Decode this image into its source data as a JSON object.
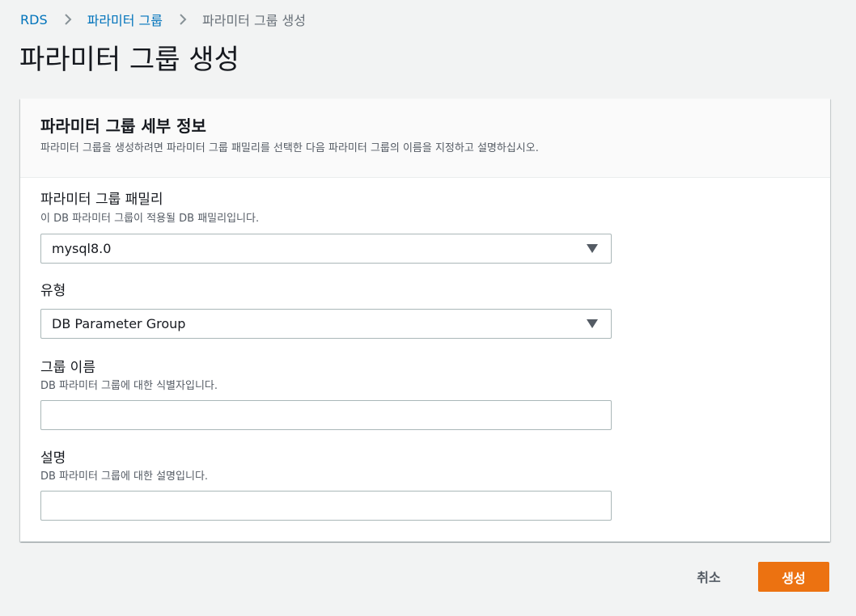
{
  "breadcrumb": {
    "items": [
      "RDS",
      "파라미터 그룹",
      "파라미터 그룹 생성"
    ]
  },
  "page": {
    "title": "파라미터 그룹 생성"
  },
  "panel": {
    "title": "파라미터 그룹 세부 정보",
    "description": "파라미터 그룹을 생성하려면 파라미터 그룹 패밀리를 선택한 다음 파라미터 그룹의 이름을 지정하고 설명하십시오."
  },
  "fields": {
    "family": {
      "label": "파라미터 그룹 패밀리",
      "description": "이 DB 파라미터 그룹이 적용될 DB 패밀리입니다.",
      "value": "mysql8.0"
    },
    "type": {
      "label": "유형",
      "value": "DB Parameter Group"
    },
    "group_name": {
      "label": "그룹 이름",
      "description": "DB 파라미터 그룹에 대한 식별자입니다.",
      "value": ""
    },
    "description": {
      "label": "설명",
      "description": "DB 파라미터 그룹에 대한 설명입니다.",
      "value": ""
    }
  },
  "actions": {
    "cancel_label": "취소",
    "create_label": "생성"
  },
  "icons": {
    "breadcrumb_separator": "chevron-right-icon",
    "select_caret": "caret-down-icon"
  },
  "colors": {
    "link": "#0073bb",
    "primary_button": "#ec7211",
    "background": "#f2f3f3"
  }
}
